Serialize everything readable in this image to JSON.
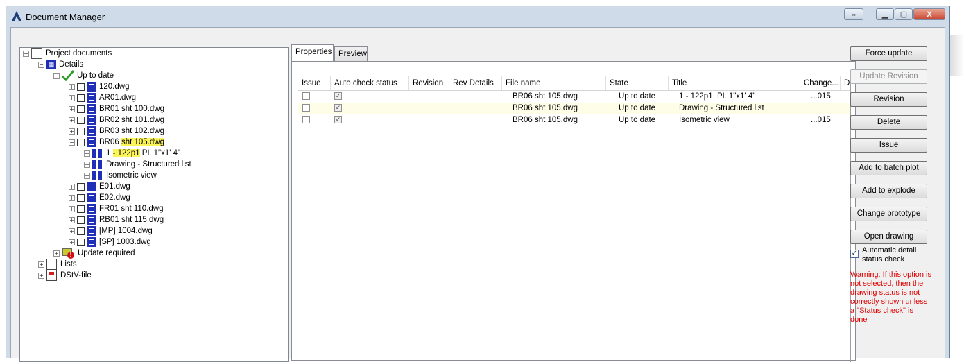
{
  "window": {
    "title": "Document Manager",
    "controls": {
      "restore_glyph": "⇔",
      "minimize_glyph": "▁",
      "maximize_glyph": "▢",
      "close_glyph": "X"
    }
  },
  "tree": {
    "root": "Project documents",
    "details": "Details",
    "up_to_date": "Up to date",
    "files": [
      "120.dwg",
      "AR01.dwg",
      "BR01 sht 100.dwg",
      "BR02 sht 101.dwg",
      "BR03 sht 102.dwg"
    ],
    "selected_file_pre": "BR06 ",
    "selected_file_hl": "sht 105.dwg",
    "subitems": {
      "first_pre": "1 ",
      "first_hl": "- 122p1",
      "first_post": " PL 1\"x1' 4\"",
      "second": "Drawing - Structured list",
      "third": "Isometric view"
    },
    "files_after": [
      "E01.dwg",
      "E02.dwg",
      "FR01 sht 110.dwg",
      "RB01 sht 115.dwg",
      "[MP] 1004.dwg",
      "[SP] 1003.dwg"
    ],
    "update_required": "Update required",
    "lists": "Lists",
    "dstv": "DStV-file"
  },
  "tabs": [
    {
      "label": "Properties",
      "active": true
    },
    {
      "label": "Preview",
      "active": false
    }
  ],
  "grid": {
    "columns": [
      "Issue",
      "Auto check status",
      "Revision",
      "Rev Details",
      "File name",
      "State",
      "Title",
      "Change...",
      "D"
    ],
    "rows": [
      {
        "issue": false,
        "auto": true,
        "file": "BR06 sht 105.dwg",
        "state": "Up to date",
        "title": "1 - 122p1  PL 1\"x1' 4\"",
        "change": "...015"
      },
      {
        "issue": false,
        "auto": true,
        "file": "BR06 sht 105.dwg",
        "state": "Up to date",
        "title": "Drawing - Structured list",
        "change": ""
      },
      {
        "issue": false,
        "auto": true,
        "file": "BR06 sht 105.dwg",
        "state": "Up to date",
        "title": "Isometric view",
        "change": "...015"
      }
    ]
  },
  "buttons": {
    "force_update": "Force update",
    "update_revision": "Update Revision",
    "revision": "Revision",
    "delete": "Delete",
    "issue": "Issue",
    "add_batch_plot": "Add to batch plot",
    "add_explode": "Add to explode",
    "change_prototype": "Change prototype",
    "open_drawing": "Open drawing"
  },
  "auto_check": {
    "label": "Automatic detail status check",
    "checked": true
  },
  "warning": "Warning: If this option is not selected, then the drawing status is not correctly shown unless a \"Status check\" is done",
  "colors": {
    "warning": "#e00000",
    "highlight": "#fcf55a",
    "drawing_icon": "#1f2fb8"
  }
}
